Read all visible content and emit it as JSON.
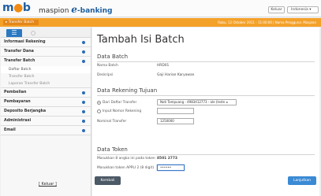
{
  "header": {
    "logo_prefix": "m",
    "logo_highlight": "●",
    "logo_suffix": "b",
    "app_name_prefix": "maspion ",
    "app_name_e": "e",
    "app_name_suffix": "-banking",
    "logout_button": "Keluar",
    "language_select": "Indonesia"
  },
  "orange_bar": {
    "breadcrumb": "Transfer Batch",
    "user_info": "Rabu, 12 Oktober 2011 - 11:00:00 | Nama Pengguna: Maspion"
  },
  "sidebar": {
    "tab_home": "☰",
    "tab_other": "○",
    "menus": [
      {
        "label": "Informasi Rekening"
      },
      {
        "label": "Transfer Dana"
      },
      {
        "label": "Transfer Batch"
      },
      {
        "label": "Pembelian"
      },
      {
        "label": "Pembayaran"
      },
      {
        "label": "Deposito Berjangka"
      },
      {
        "label": "Administrasi"
      },
      {
        "label": "Email"
      }
    ],
    "submenu": [
      {
        "label": "Daftar Batch"
      },
      {
        "label": "Transfer Batch"
      },
      {
        "label": "Laporan Transfer Batch"
      }
    ],
    "logout": "[ Keluar ]"
  },
  "main": {
    "title": "Tambah Isi Batch",
    "data_batch": {
      "heading": "Data Batch",
      "rows": [
        {
          "label": "Nama Batch",
          "value": "HRD01"
        },
        {
          "label": "Deskripsi",
          "value": "Gaji Harian Karyawan"
        }
      ]
    },
    "rekening_tujuan": {
      "heading": "Data Rekening Tujuan",
      "option_from_list": "Dari Daftar Transfer",
      "option_from_list_value": "Noti Tampuang - 4983412773 - ale (leste  ◂",
      "option_input": "Input Nomor Rekening",
      "nominal_label": "Nominal Transfer",
      "nominal_value": "1250000"
    },
    "data_token": {
      "heading": "Data Token",
      "token_label": "Masukkan 8 angka ini pada token",
      "token_value": "8501 2773",
      "appli_label": "Masukkan token APPLI 2 (8 digit)",
      "appli_value": "••••••"
    },
    "back_button": "Kembali",
    "continue_button": "Lanjutkan"
  }
}
